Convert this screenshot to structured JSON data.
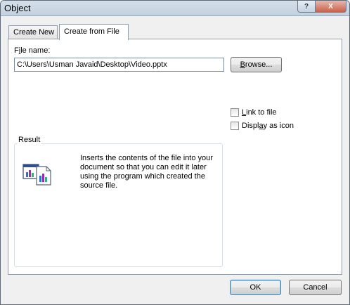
{
  "window": {
    "title": "Object",
    "help_label": "?",
    "close_label": "X"
  },
  "tabs": [
    {
      "label": "Create New",
      "selected": false
    },
    {
      "label": "Create from File",
      "selected": true
    }
  ],
  "file": {
    "label_prefix": "F",
    "label_underlined": "i",
    "label_suffix": "le name:",
    "value": "C:\\Users\\Usman Javaid\\Desktop\\Video.pptx"
  },
  "buttons": {
    "browse_underlined": "B",
    "browse_rest": "rowse...",
    "ok": "OK",
    "cancel": "Cancel"
  },
  "options": {
    "link_underlined": "L",
    "link_rest": "ink to file",
    "link_checked": false,
    "display_prefix": "Displ",
    "display_underlined": "a",
    "display_suffix": "y as icon",
    "display_checked": false
  },
  "result": {
    "label": "Result",
    "text": "Inserts the contents of the file into your document so that you can edit it later using the program which created the source file.",
    "icon": "insert-file-object-icon"
  },
  "colors": {
    "accent": "#3c7fb1",
    "frame": "#5e6a78",
    "face": "#f0f0f0"
  }
}
